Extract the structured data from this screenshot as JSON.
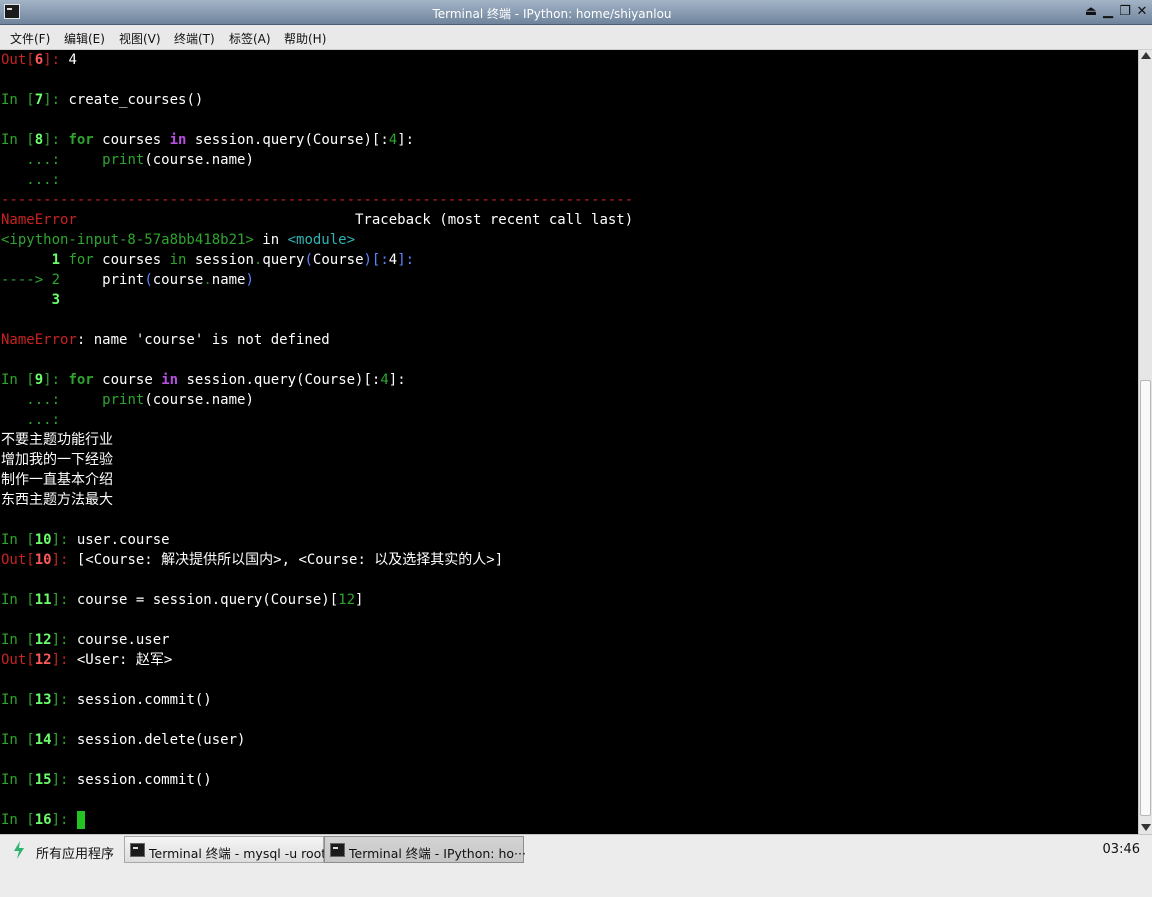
{
  "window": {
    "title": "Terminal 终端 - IPython: home/shiyanlou"
  },
  "menu": [
    {
      "label": "文件(F)"
    },
    {
      "label": "编辑(E)"
    },
    {
      "label": "视图(V)"
    },
    {
      "label": "终端(T)"
    },
    {
      "label": "标签(A)"
    },
    {
      "label": "帮助(H)"
    }
  ],
  "terminal": {
    "lines": [
      [
        {
          "t": "Out[",
          "c": "r"
        },
        {
          "t": "6",
          "c": "rb"
        },
        {
          "t": "]: ",
          "c": "r"
        },
        {
          "t": "4",
          "c": "w"
        }
      ],
      [],
      [
        {
          "t": "In [",
          "c": "g"
        },
        {
          "t": "7",
          "c": "gb"
        },
        {
          "t": "]: ",
          "c": "g"
        },
        {
          "t": "create_courses()",
          "c": "w"
        }
      ],
      [],
      [
        {
          "t": "In [",
          "c": "g"
        },
        {
          "t": "8",
          "c": "gb"
        },
        {
          "t": "]: ",
          "c": "g"
        },
        {
          "t": "for",
          "c": "kw"
        },
        {
          "t": " courses ",
          "c": "w"
        },
        {
          "t": "in",
          "c": "mag"
        },
        {
          "t": " session.query(Course)[:",
          "c": "w"
        },
        {
          "t": "4",
          "c": "num"
        },
        {
          "t": "]:",
          "c": "w"
        }
      ],
      [
        {
          "t": "   ...: ",
          "c": "g"
        },
        {
          "t": "    ",
          "c": "w"
        },
        {
          "t": "print",
          "c": "g"
        },
        {
          "t": "(course.name)",
          "c": "w"
        }
      ],
      [
        {
          "t": "   ...: ",
          "c": "g"
        }
      ],
      [
        {
          "t": "---------------------------------------------------------------------------",
          "c": "r"
        }
      ],
      [
        {
          "t": "NameError",
          "c": "r"
        },
        {
          "t": "                                 Traceback (most recent call last)",
          "c": "w"
        }
      ],
      [
        {
          "t": "<ipython-input-8-57a8bb418b21>",
          "c": "g"
        },
        {
          "t": " in ",
          "c": "w"
        },
        {
          "t": "<module>",
          "c": "cy"
        }
      ],
      [
        {
          "t": "      1",
          "c": "gb"
        },
        {
          "t": " for",
          "c": "g"
        },
        {
          "t": " courses ",
          "c": "w"
        },
        {
          "t": "in",
          "c": "g"
        },
        {
          "t": " session",
          "c": "w"
        },
        {
          "t": ".",
          "c": "dim"
        },
        {
          "t": "query",
          "c": "w"
        },
        {
          "t": "(",
          "c": "blu"
        },
        {
          "t": "Course",
          "c": "w"
        },
        {
          "t": ")[:",
          "c": "blu"
        },
        {
          "t": "4",
          "c": "w"
        },
        {
          "t": "]:",
          "c": "blu"
        }
      ],
      [
        {
          "t": "----> 2",
          "c": "g"
        },
        {
          "t": "     print",
          "c": "w"
        },
        {
          "t": "(",
          "c": "blu"
        },
        {
          "t": "course",
          "c": "w"
        },
        {
          "t": ".",
          "c": "dim"
        },
        {
          "t": "name",
          "c": "w"
        },
        {
          "t": ")",
          "c": "blu"
        }
      ],
      [
        {
          "t": "      3",
          "c": "gb"
        }
      ],
      [],
      [
        {
          "t": "NameError",
          "c": "r"
        },
        {
          "t": ": name 'course' is not defined",
          "c": "w"
        }
      ],
      [],
      [
        {
          "t": "In [",
          "c": "g"
        },
        {
          "t": "9",
          "c": "gb"
        },
        {
          "t": "]: ",
          "c": "g"
        },
        {
          "t": "for",
          "c": "kw"
        },
        {
          "t": " course ",
          "c": "w"
        },
        {
          "t": "in",
          "c": "mag"
        },
        {
          "t": " session.query(Course)[:",
          "c": "w"
        },
        {
          "t": "4",
          "c": "num"
        },
        {
          "t": "]:",
          "c": "w"
        }
      ],
      [
        {
          "t": "   ...: ",
          "c": "g"
        },
        {
          "t": "    ",
          "c": "w"
        },
        {
          "t": "print",
          "c": "g"
        },
        {
          "t": "(course.name)",
          "c": "w"
        }
      ],
      [
        {
          "t": "   ...: ",
          "c": "g"
        }
      ],
      [
        {
          "t": "不要主题功能行业",
          "c": "w"
        }
      ],
      [
        {
          "t": "增加我的一下经验",
          "c": "w"
        }
      ],
      [
        {
          "t": "制作一直基本介绍",
          "c": "w"
        }
      ],
      [
        {
          "t": "东西主题方法最大",
          "c": "w"
        }
      ],
      [],
      [
        {
          "t": "In [",
          "c": "g"
        },
        {
          "t": "10",
          "c": "gb"
        },
        {
          "t": "]: ",
          "c": "g"
        },
        {
          "t": "user.course",
          "c": "w"
        }
      ],
      [
        {
          "t": "Out[",
          "c": "r"
        },
        {
          "t": "10",
          "c": "rb"
        },
        {
          "t": "]: ",
          "c": "r"
        },
        {
          "t": "[<Course: 解决提供所以国内>, <Course: 以及选择其实的人>]",
          "c": "w"
        }
      ],
      [],
      [
        {
          "t": "In [",
          "c": "g"
        },
        {
          "t": "11",
          "c": "gb"
        },
        {
          "t": "]: ",
          "c": "g"
        },
        {
          "t": "course = session.query(Course)[",
          "c": "w"
        },
        {
          "t": "12",
          "c": "num"
        },
        {
          "t": "]",
          "c": "w"
        }
      ],
      [],
      [
        {
          "t": "In [",
          "c": "g"
        },
        {
          "t": "12",
          "c": "gb"
        },
        {
          "t": "]: ",
          "c": "g"
        },
        {
          "t": "course.user",
          "c": "w"
        }
      ],
      [
        {
          "t": "Out[",
          "c": "r"
        },
        {
          "t": "12",
          "c": "rb"
        },
        {
          "t": "]: ",
          "c": "r"
        },
        {
          "t": "<User: 赵军>",
          "c": "w"
        }
      ],
      [],
      [
        {
          "t": "In [",
          "c": "g"
        },
        {
          "t": "13",
          "c": "gb"
        },
        {
          "t": "]: ",
          "c": "g"
        },
        {
          "t": "session.commit()",
          "c": "w"
        }
      ],
      [],
      [
        {
          "t": "In [",
          "c": "g"
        },
        {
          "t": "14",
          "c": "gb"
        },
        {
          "t": "]: ",
          "c": "g"
        },
        {
          "t": "session.delete(user)",
          "c": "w"
        }
      ],
      [],
      [
        {
          "t": "In [",
          "c": "g"
        },
        {
          "t": "15",
          "c": "gb"
        },
        {
          "t": "]: ",
          "c": "g"
        },
        {
          "t": "session.commit()",
          "c": "w"
        }
      ],
      [],
      [
        {
          "t": "In [",
          "c": "g"
        },
        {
          "t": "16",
          "c": "gb"
        },
        {
          "t": "]: ",
          "c": "g"
        }
      ]
    ]
  },
  "taskbar": {
    "start_label": "所有应用程序",
    "tasks": [
      {
        "label": "Terminal 终端 - mysql -u root"
      },
      {
        "label": "Terminal 终端 - IPython: ho···"
      }
    ],
    "clock": "03:46"
  },
  "colors": {
    "terminal_bg": "#000000",
    "prompt_in": "#2fa52f",
    "prompt_out": "#c72323"
  }
}
